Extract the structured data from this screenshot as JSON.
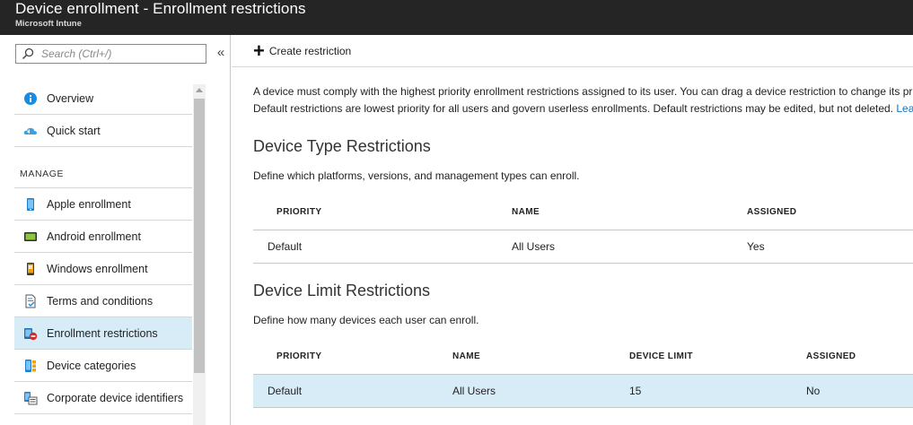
{
  "header": {
    "title": "Device enrollment - Enrollment restrictions",
    "subtitle": "Microsoft Intune"
  },
  "sidebar": {
    "search_placeholder": "Search (Ctrl+/)",
    "collapse_label": "«",
    "items_top": [
      {
        "label": "Overview",
        "icon": "info-icon"
      },
      {
        "label": "Quick start",
        "icon": "cloud-icon"
      }
    ],
    "section_label": "MANAGE",
    "items_manage": [
      {
        "label": "Apple enrollment",
        "icon": "phone-icon"
      },
      {
        "label": "Android enrollment",
        "icon": "tablet-icon"
      },
      {
        "label": "Windows enrollment",
        "icon": "windows-device-icon"
      },
      {
        "label": "Terms and conditions",
        "icon": "document-check-icon"
      },
      {
        "label": "Enrollment restrictions",
        "icon": "restriction-icon",
        "active": true
      },
      {
        "label": "Device categories",
        "icon": "categories-icon"
      },
      {
        "label": "Corporate device identifiers",
        "icon": "identifiers-icon"
      }
    ]
  },
  "toolbar": {
    "create_label": "Create restriction"
  },
  "main": {
    "description_line1": "A device must comply with the highest priority enrollment restrictions assigned to its user. You can drag a device restriction to change its pr",
    "description_line2": "Default restrictions are lowest priority for all users and govern userless enrollments. Default restrictions may be edited, but not deleted. ",
    "learn_link": "Lea",
    "type_section": {
      "title": "Device Type Restrictions",
      "subtitle": "Define which platforms, versions, and management types can enroll.",
      "columns": [
        "PRIORITY",
        "NAME",
        "ASSIGNED"
      ],
      "rows": [
        {
          "priority": "Default",
          "name": "All Users",
          "assigned": "Yes"
        }
      ]
    },
    "limit_section": {
      "title": "Device Limit Restrictions",
      "subtitle": "Define how many devices each user can enroll.",
      "columns": [
        "PRIORITY",
        "NAME",
        "DEVICE LIMIT",
        "ASSIGNED"
      ],
      "rows": [
        {
          "priority": "Default",
          "name": "All Users",
          "limit": "15",
          "assigned": "No",
          "selected": true
        }
      ]
    }
  },
  "colors": {
    "header_bg": "#252526",
    "active_bg": "#d8ecf8",
    "link": "#0078d4"
  }
}
